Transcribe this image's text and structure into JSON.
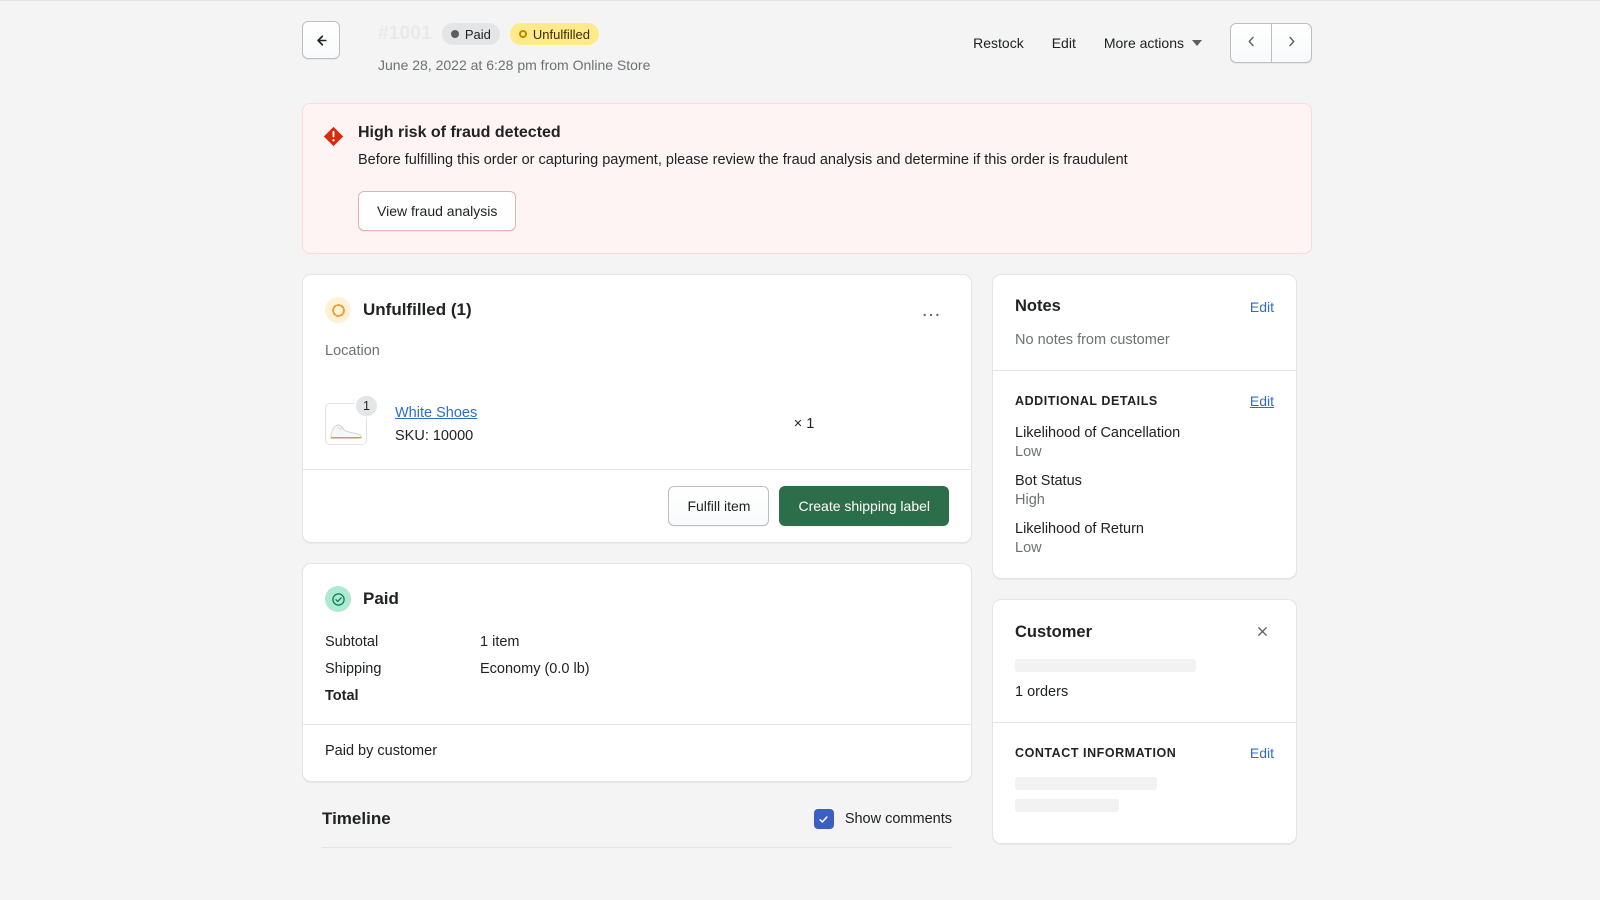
{
  "header": {
    "back_icon": "arrow-left-icon",
    "order_number": "#1001",
    "badges": [
      {
        "label": "Paid",
        "kind": "paid"
      },
      {
        "label": "Unfulfilled",
        "kind": "unfulfilled"
      }
    ],
    "meta": "June 28, 2022 at 6:28 pm from Online Store",
    "actions": {
      "restock": "Restock",
      "edit": "Edit",
      "more_actions": "More actions"
    },
    "pager": {
      "prev_icon": "chevron-left-icon",
      "next_icon": "chevron-right-icon"
    }
  },
  "fraud_banner": {
    "icon": "alert-diamond-icon",
    "title": "High risk of fraud detected",
    "body": "Before fulfilling this order or capturing payment, please review the fraud analysis and determine if this order is fraudulent",
    "button": "View fraud analysis"
  },
  "fulfillment": {
    "icon": "fulfillment-pending-icon",
    "title": "Unfulfilled (1)",
    "kebab": "…",
    "location_label": "Location",
    "location_value": "",
    "item": {
      "quantity_badge": "1",
      "title": "White Shoes",
      "sku": "SKU: 10000",
      "unit_price": "",
      "quantity": "× 1",
      "line_total": "",
      "thumbnail_icon": "shoe-thumbnail"
    },
    "fulfill_button": "Fulfill item",
    "shipping_label_button": "Create shipping label"
  },
  "payment": {
    "icon": "paid-check-icon",
    "title": "Paid",
    "rows": [
      {
        "label": "Subtotal",
        "detail": "1 item",
        "amount": ""
      },
      {
        "label": "Shipping",
        "detail": "Economy (0.0 lb)",
        "amount": ""
      },
      {
        "label": "Total",
        "detail": "",
        "amount": ""
      }
    ],
    "paid_by_label": "Paid by customer",
    "paid_by_amount": ""
  },
  "timeline": {
    "title": "Timeline",
    "show_comments_label": "Show comments",
    "show_comments_checked": true,
    "checkbox_color": "#3b5fc0"
  },
  "sidebar": {
    "notes": {
      "title": "Notes",
      "edit": "Edit",
      "empty_text": "No notes from customer"
    },
    "additional_details": {
      "title": "Additional details",
      "edit": "Edit",
      "items": [
        {
          "label": "Likelihood of Cancellation",
          "value": "Low"
        },
        {
          "label": "Bot Status",
          "value": "High"
        },
        {
          "label": "Likelihood of Return",
          "value": "Low"
        }
      ]
    },
    "customer": {
      "title": "Customer",
      "close_icon": "close-icon",
      "name": "",
      "orders": "1 orders"
    },
    "contact_information": {
      "title": "Contact information",
      "edit": "Edit",
      "email": "",
      "phone": ""
    }
  },
  "colors": {
    "page_bg": "#f4f4f4",
    "primary_green": "#2c6e49",
    "link_blue": "#2c6ecb",
    "checkbox_blue": "#3b5fc0",
    "badge_yellow": "#ffea8a",
    "badge_gray": "#e4e5e7",
    "banner_bg": "#fff4f4",
    "banner_border": "#fdd9d9",
    "critical_red": "#d72c0d"
  }
}
